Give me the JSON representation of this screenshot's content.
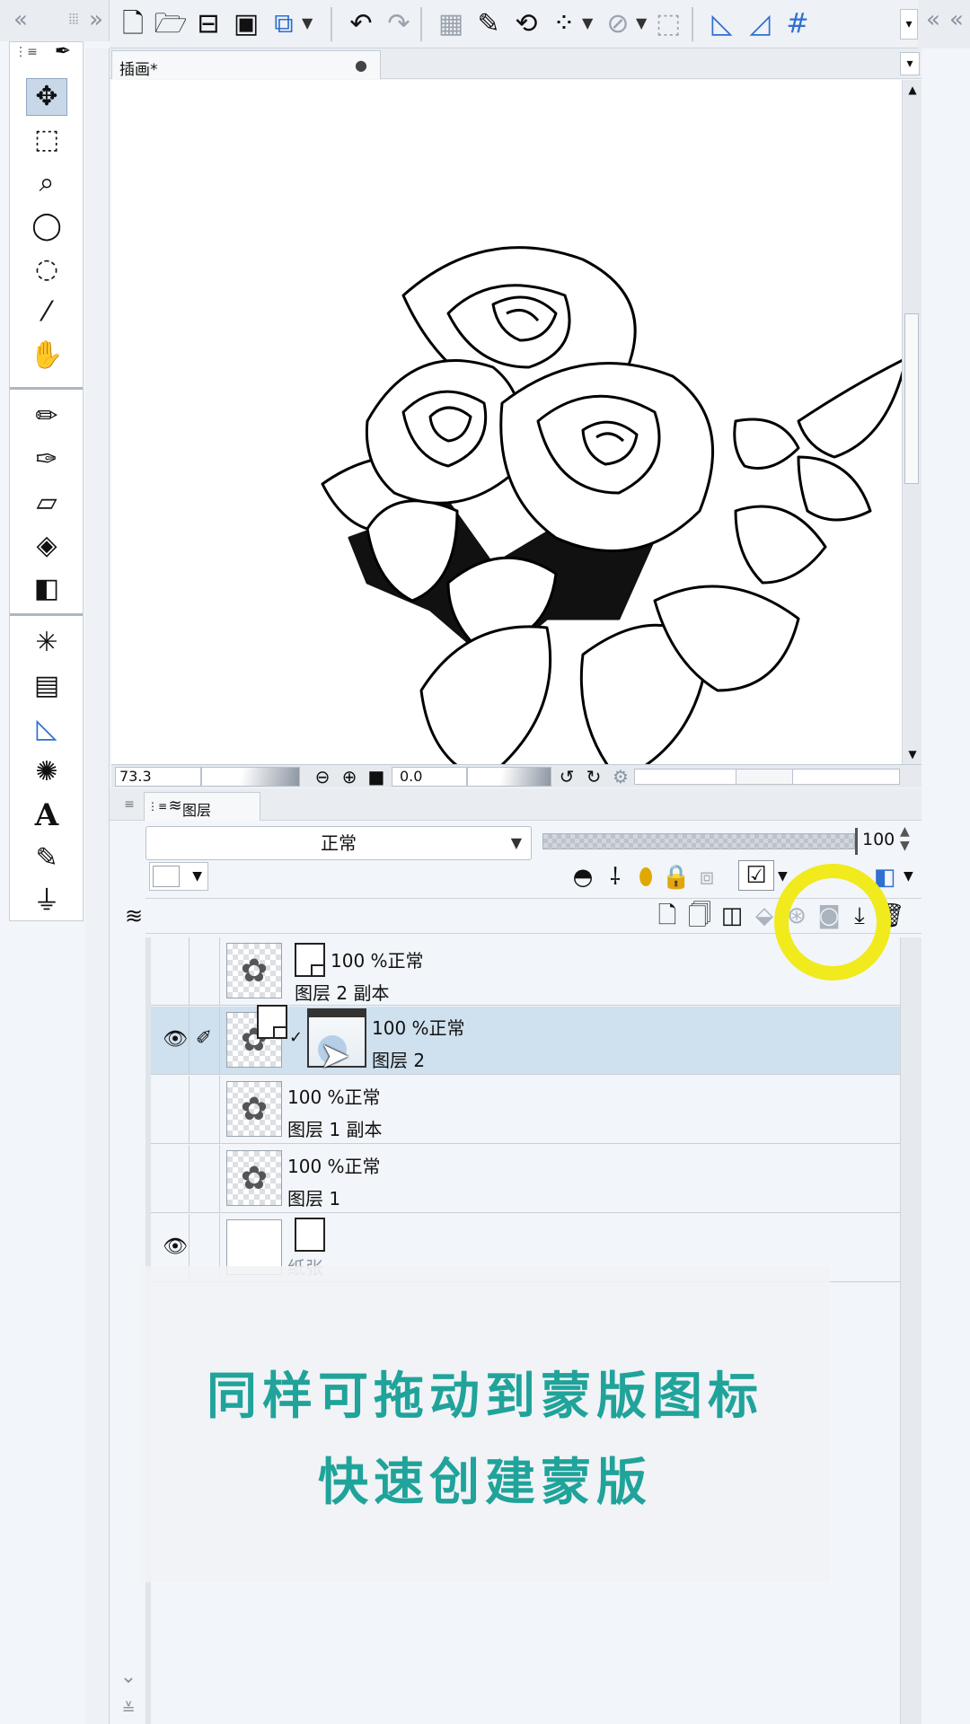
{
  "toolbar": {
    "icons": [
      "new-file",
      "open-folder",
      "window",
      "save",
      "auto-action",
      "undo",
      "redo",
      "clear",
      "eyedropper",
      "transform",
      "selection",
      "snap",
      "ruler",
      "perspective",
      "grid"
    ]
  },
  "document": {
    "tab_title": "插画*",
    "tab_dot": "●",
    "zoom": "73.3",
    "rotation": "0.0"
  },
  "layer_panel": {
    "tab_label": "图层",
    "blend_mode": "正常",
    "opacity": "100",
    "opacity_fraction": 1.0,
    "layers": [
      {
        "mode": "100 %正常",
        "name": "图层 2 副本",
        "visible": false,
        "editing": false,
        "selected": false,
        "has_mask": false
      },
      {
        "mode": "100 %正常",
        "name": "图层 2",
        "visible": true,
        "editing": true,
        "selected": true,
        "has_mask": true
      },
      {
        "mode": "100 %正常",
        "name": "图层 1 副本",
        "visible": false,
        "editing": false,
        "selected": false,
        "has_mask": false
      },
      {
        "mode": "100 %正常",
        "name": "图层 1",
        "visible": false,
        "editing": false,
        "selected": false,
        "has_mask": false
      },
      {
        "mode": "",
        "name": "纸张",
        "visible": true,
        "editing": false,
        "selected": false,
        "has_mask": false
      }
    ]
  },
  "caption": {
    "line1": "同样可拖动到蒙版图标",
    "line2": "快速创建蒙版",
    "color": "#20a39a"
  },
  "highlight_color": "#f1ea1d"
}
